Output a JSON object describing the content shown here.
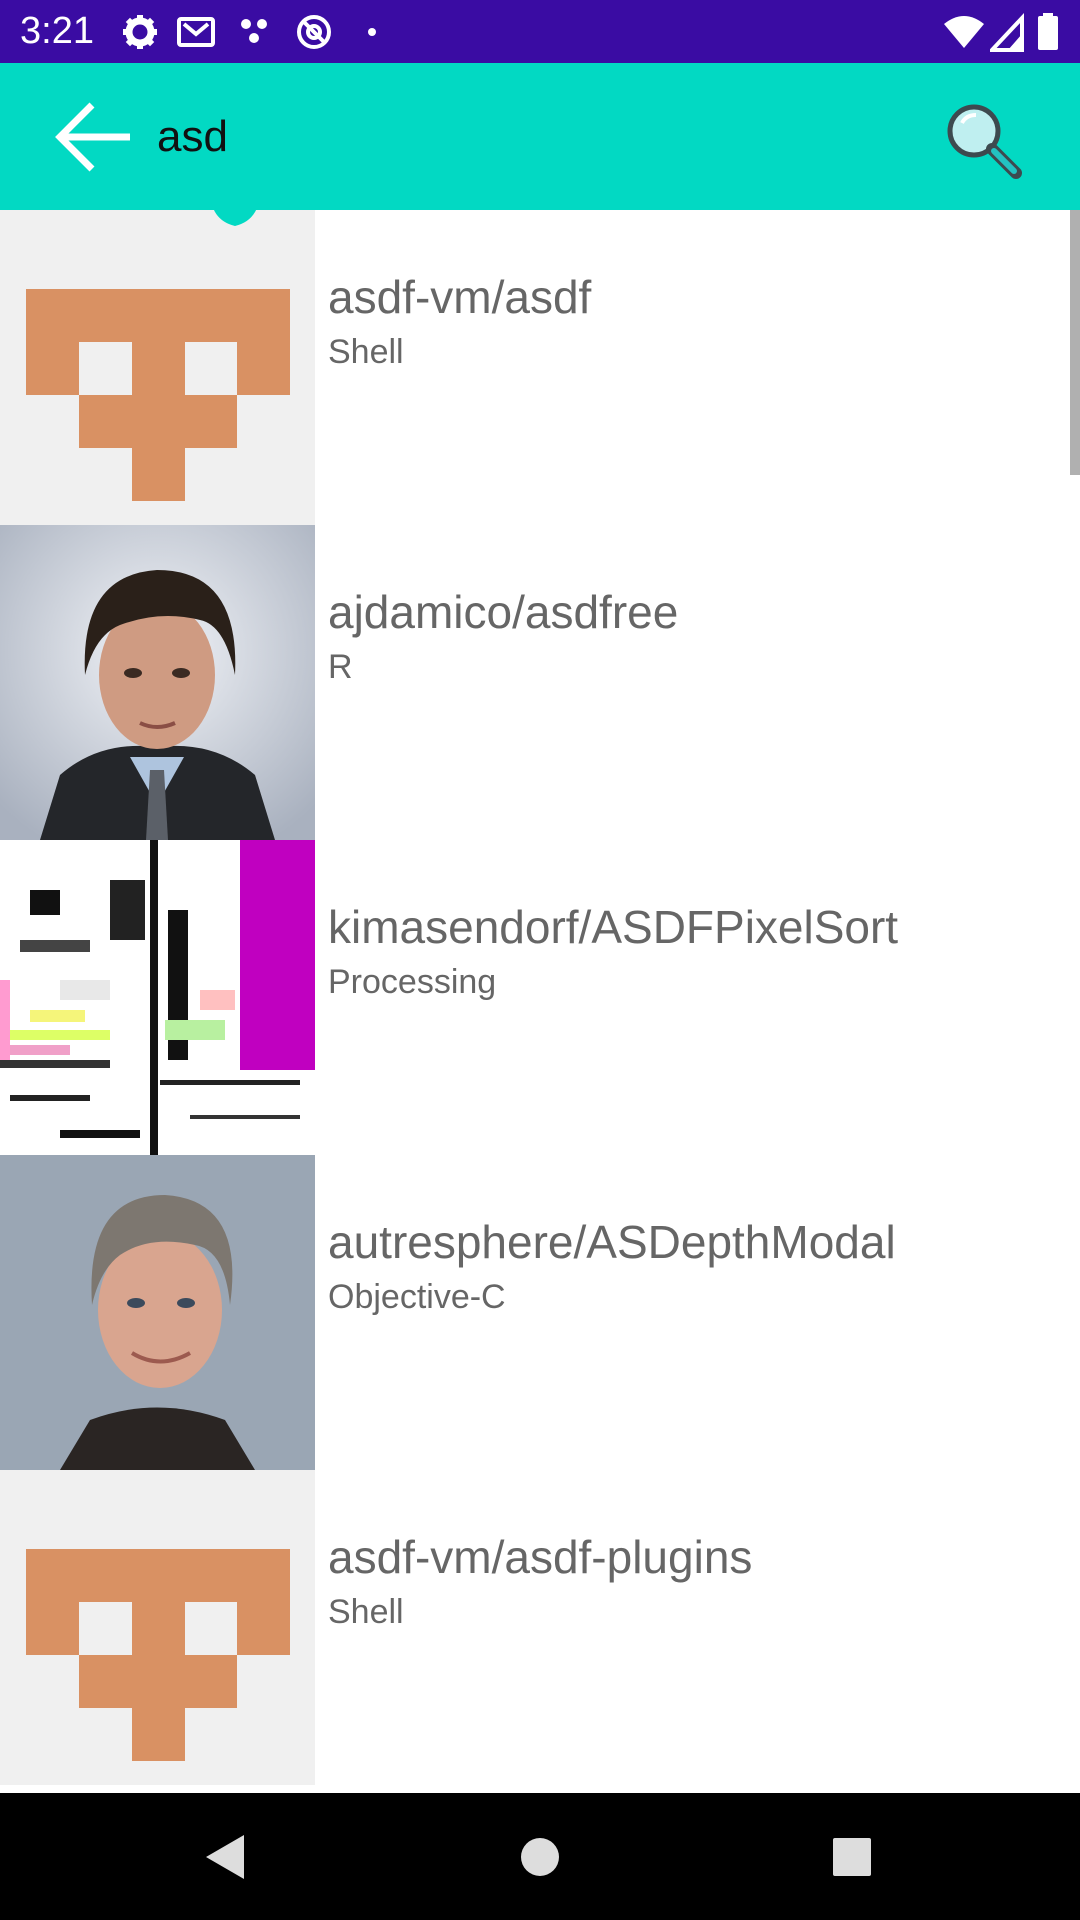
{
  "status_bar": {
    "time": "3:21",
    "icons_left": [
      "settings-icon",
      "gmail-icon",
      "dots-icon",
      "sync-off-icon",
      "dot-icon"
    ],
    "icons_right": [
      "wifi-icon",
      "signal-icon",
      "battery-icon"
    ],
    "background": "#3a0ca3"
  },
  "app_bar": {
    "query": "asd",
    "background": "#02d9c3",
    "back_icon": "arrow-back-icon",
    "search_icon": "search-icon"
  },
  "results": [
    {
      "name": "asdf-vm/asdf",
      "language": "Shell",
      "avatar": "identicon-orange"
    },
    {
      "name": "ajdamico/asdfree",
      "language": "R",
      "avatar": "portrait-photo"
    },
    {
      "name": "kimasendorf/ASDFPixelSort",
      "language": "Processing",
      "avatar": "pixel-sort-art"
    },
    {
      "name": "autresphere/ASDepthModal",
      "language": "Objective-C",
      "avatar": "portrait-photo"
    },
    {
      "name": "asdf-vm/asdf-plugins",
      "language": "Shell",
      "avatar": "identicon-orange"
    }
  ],
  "nav_bar": {
    "buttons": [
      "back-triangle-icon",
      "home-circle-icon",
      "recents-square-icon"
    ]
  },
  "colors": {
    "identicon": "#d99163",
    "identicon_bg": "#f0f0f0",
    "text_secondary": "#666666"
  }
}
